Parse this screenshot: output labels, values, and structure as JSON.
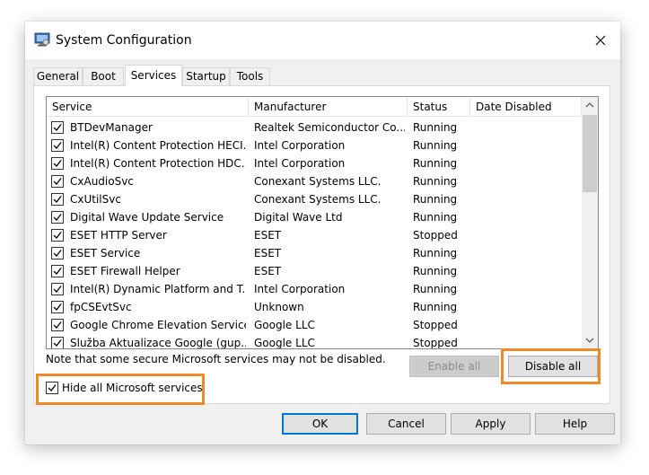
{
  "window": {
    "title": "System Configuration"
  },
  "tabs": [
    {
      "label": "General"
    },
    {
      "label": "Boot"
    },
    {
      "label": "Services",
      "active": true
    },
    {
      "label": "Startup"
    },
    {
      "label": "Tools"
    }
  ],
  "columns": [
    "Service",
    "Manufacturer",
    "Status",
    "Date Disabled"
  ],
  "services": [
    {
      "checked": true,
      "service": "BTDevManager",
      "manufacturer": "Realtek Semiconductor Co...",
      "status": "Running",
      "date_disabled": ""
    },
    {
      "checked": true,
      "service": "Intel(R) Content Protection HECI...",
      "manufacturer": "Intel Corporation",
      "status": "Running",
      "date_disabled": ""
    },
    {
      "checked": true,
      "service": "Intel(R) Content Protection HDC...",
      "manufacturer": "Intel Corporation",
      "status": "Running",
      "date_disabled": ""
    },
    {
      "checked": true,
      "service": "CxAudioSvc",
      "manufacturer": "Conexant Systems LLC.",
      "status": "Running",
      "date_disabled": ""
    },
    {
      "checked": true,
      "service": "CxUtilSvc",
      "manufacturer": "Conexant Systems LLC.",
      "status": "Running",
      "date_disabled": ""
    },
    {
      "checked": true,
      "service": "Digital Wave Update Service",
      "manufacturer": "Digital Wave Ltd",
      "status": "Running",
      "date_disabled": ""
    },
    {
      "checked": true,
      "service": "ESET HTTP Server",
      "manufacturer": "ESET",
      "status": "Stopped",
      "date_disabled": ""
    },
    {
      "checked": true,
      "service": "ESET Service",
      "manufacturer": "ESET",
      "status": "Running",
      "date_disabled": ""
    },
    {
      "checked": true,
      "service": "ESET Firewall Helper",
      "manufacturer": "ESET",
      "status": "Running",
      "date_disabled": ""
    },
    {
      "checked": true,
      "service": "Intel(R) Dynamic Platform and T...",
      "manufacturer": "Intel Corporation",
      "status": "Running",
      "date_disabled": ""
    },
    {
      "checked": true,
      "service": "fpCSEvtSvc",
      "manufacturer": "Unknown",
      "status": "Running",
      "date_disabled": ""
    },
    {
      "checked": true,
      "service": "Google Chrome Elevation Service",
      "manufacturer": "Google LLC",
      "status": "Stopped",
      "date_disabled": ""
    },
    {
      "checked": true,
      "service": "Služba Aktualizace Google (gup...",
      "manufacturer": "Google LLC",
      "status": "Stopped",
      "date_disabled": ""
    }
  ],
  "note": "Note that some secure Microsoft services may not be disabled.",
  "buttons": {
    "enable_all": "Enable all",
    "disable_all": "Disable all",
    "ok": "OK",
    "cancel": "Cancel",
    "apply": "Apply",
    "help": "Help"
  },
  "hide_microsoft": {
    "label": "Hide all Microsoft services",
    "checked": true
  },
  "colors": {
    "highlight": "#f08a24",
    "default_button_border": "#0078d7"
  },
  "icons": {
    "app": "msconfig-icon",
    "close": "close-icon",
    "scroll_up": "chevron-up-icon",
    "scroll_down": "chevron-down-icon",
    "check": "checkmark-icon"
  }
}
